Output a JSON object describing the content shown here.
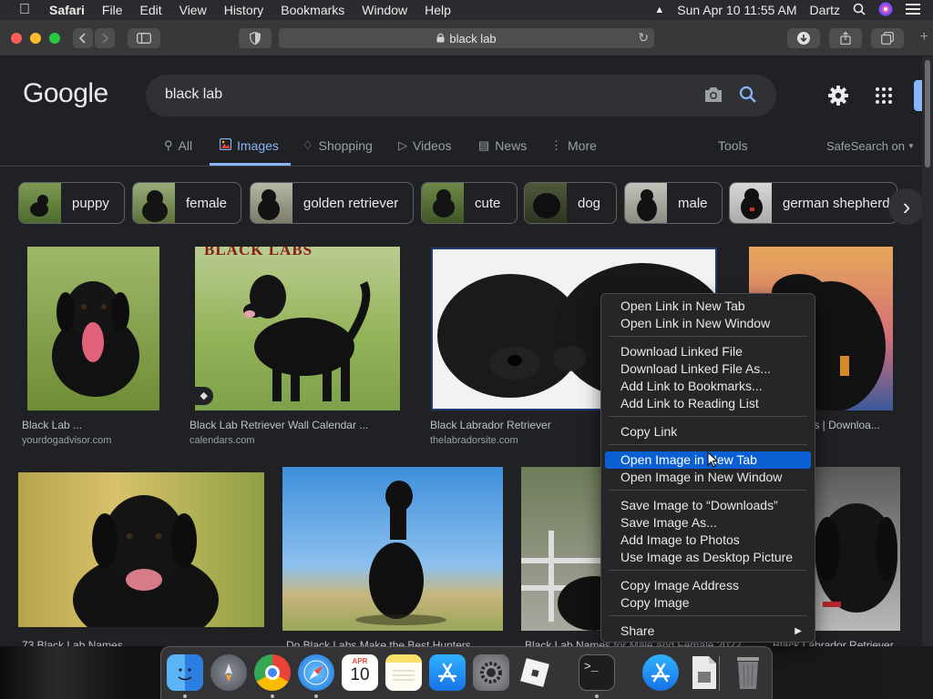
{
  "menubar": {
    "app_name": "Safari",
    "items": [
      "File",
      "Edit",
      "View",
      "History",
      "Bookmarks",
      "Window",
      "Help"
    ],
    "date_time": "Sun Apr 10  11:55 AM",
    "user": "Dartz"
  },
  "toolbar": {
    "url": "black lab"
  },
  "google": {
    "logo_text": "Google",
    "query": "black lab",
    "tabs": [
      "All",
      "Images",
      "Shopping",
      "Videos",
      "News",
      "More"
    ],
    "tools": "Tools",
    "safesearch": "SafeSearch on"
  },
  "chips": [
    "puppy",
    "female",
    "golden retriever",
    "cute",
    "dog",
    "male",
    "german shepherd"
  ],
  "results": [
    {
      "title": "Black Lab ...",
      "source": "yourdogadvisor.com"
    },
    {
      "title": "Black Lab Retriever Wall Calendar ...",
      "source": "calendars.com"
    },
    {
      "title": "Black Labrador Retriever",
      "source": "thelabradorsite.com"
    },
    {
      "title": "ures | Downloa...",
      "source": ""
    },
    {
      "title": "73 Black Lab Names",
      "source": ""
    },
    {
      "title": "Do Black Labs Make the Best Hunters",
      "source": ""
    },
    {
      "title": "Black Lab Names for Male and Female 2022",
      "source": ""
    },
    {
      "title": "Black Labrador Retriever",
      "source": ""
    }
  ],
  "calendar_banner": "BLACK LABS",
  "context_menu": {
    "items": [
      "Open Link in New Tab",
      "Open Link in New Window",
      "Download Linked File",
      "Download Linked File As...",
      "Add Link to Bookmarks...",
      "Add Link to Reading List",
      "Copy Link",
      "Open Image in New Tab",
      "Open Image in New Window",
      "Save Image to “Downloads”",
      "Save Image As...",
      "Add Image to Photos",
      "Use Image as Desktop Picture",
      "Copy Image Address",
      "Copy Image",
      "Share"
    ],
    "highlighted_index": 7
  },
  "dock": {
    "calendar_month": "APR",
    "calendar_day": "10",
    "apps": [
      "Finder",
      "Launchpad",
      "Chrome",
      "Safari",
      "Calendar",
      "Notes",
      "App Store",
      "System Preferences",
      "Roblox",
      "Terminal",
      "App Store Installer",
      "Preview Document",
      "Trash"
    ]
  },
  "colors": {
    "accent": "#8ab4f8",
    "menu_highlight": "#0a5fd2",
    "page_bg": "#202124"
  }
}
